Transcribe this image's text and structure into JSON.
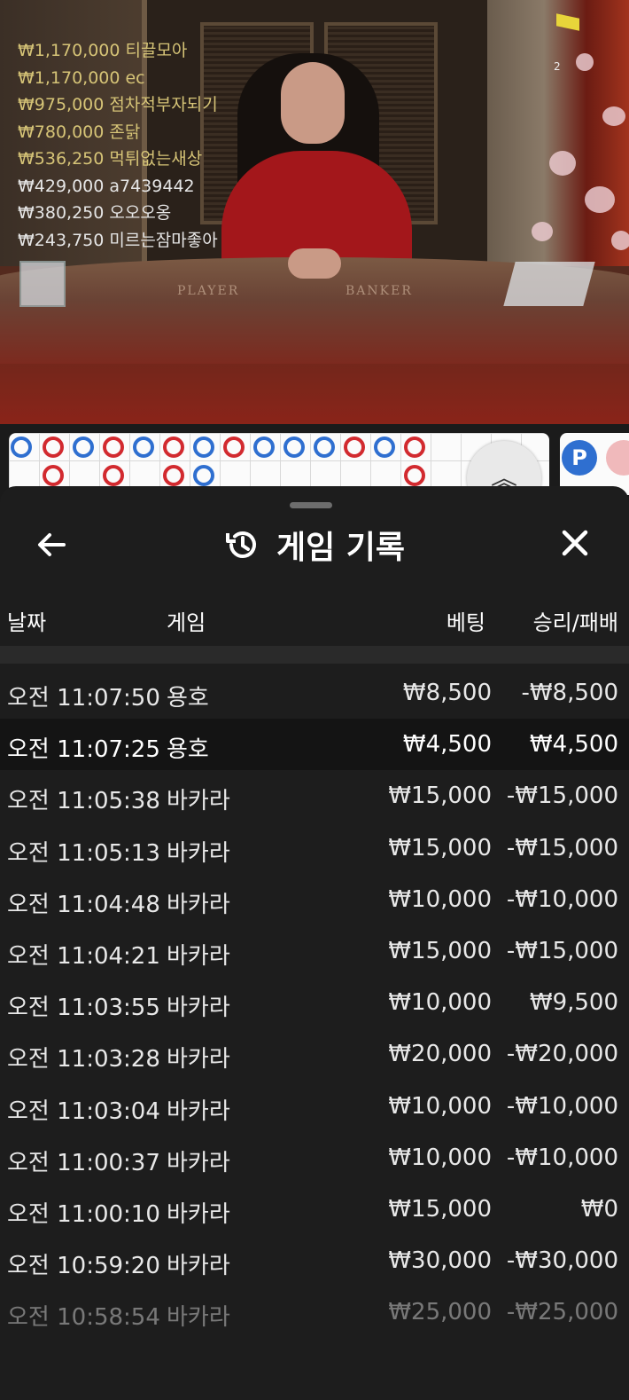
{
  "video": {
    "overlay_number": "2",
    "table_labels": {
      "player": "PLAYER",
      "banker": "BANKER"
    },
    "leaderboard": [
      {
        "amount": "₩1,170,000",
        "name": "티끌모아",
        "style": "gold"
      },
      {
        "amount": "₩1,170,000",
        "name": "ec",
        "style": "gold"
      },
      {
        "amount": "₩975,000",
        "name": "점차적부자되기",
        "style": "gold"
      },
      {
        "amount": "₩780,000",
        "name": "존닭",
        "style": "gold"
      },
      {
        "amount": "₩536,250",
        "name": "먹튀없는새상",
        "style": "gold"
      },
      {
        "amount": "₩429,000",
        "name": "a7439442",
        "style": "white"
      },
      {
        "amount": "₩380,250",
        "name": "오오오옹",
        "style": "white"
      },
      {
        "amount": "₩243,750",
        "name": "미르는잠마좋아",
        "style": "white"
      }
    ]
  },
  "roadmap": {
    "side_badge": "P",
    "collapse_icon": "chevron-double-up-icon",
    "colors": {
      "banker": "#d22a2f",
      "player": "#2f6fd0"
    }
  },
  "sheet": {
    "title": "게임 기록",
    "title_icon": "history-icon",
    "back_icon": "arrow-left-icon",
    "close_icon": "close-icon",
    "headers": {
      "date": "날짜",
      "game": "게임",
      "bet": "베팅",
      "result": "승리/패배"
    },
    "rows": [
      {
        "date": "오전 11:07:50",
        "game": "용호",
        "bet": "₩8,500",
        "result": "-₩8,500"
      },
      {
        "date": "오전 11:07:25",
        "game": "용호",
        "bet": "₩4,500",
        "result": "₩4,500"
      },
      {
        "date": "오전 11:05:38",
        "game": "바카라",
        "bet": "₩15,000",
        "result": "-₩15,000"
      },
      {
        "date": "오전 11:05:13",
        "game": "바카라",
        "bet": "₩15,000",
        "result": "-₩15,000"
      },
      {
        "date": "오전 11:04:48",
        "game": "바카라",
        "bet": "₩10,000",
        "result": "-₩10,000"
      },
      {
        "date": "오전 11:04:21",
        "game": "바카라",
        "bet": "₩15,000",
        "result": "-₩15,000"
      },
      {
        "date": "오전 11:03:55",
        "game": "바카라",
        "bet": "₩10,000",
        "result": "₩9,500"
      },
      {
        "date": "오전 11:03:28",
        "game": "바카라",
        "bet": "₩20,000",
        "result": "-₩20,000"
      },
      {
        "date": "오전 11:03:04",
        "game": "바카라",
        "bet": "₩10,000",
        "result": "-₩10,000"
      },
      {
        "date": "오전 11:00:37",
        "game": "바카라",
        "bet": "₩10,000",
        "result": "-₩10,000"
      },
      {
        "date": "오전 11:00:10",
        "game": "바카라",
        "bet": "₩15,000",
        "result": "₩0"
      },
      {
        "date": "오전 10:59:20",
        "game": "바카라",
        "bet": "₩30,000",
        "result": "-₩30,000"
      },
      {
        "date": "오전 10:58:54",
        "game": "바카라",
        "bet": "₩25,000",
        "result": "-₩25,000"
      }
    ]
  }
}
